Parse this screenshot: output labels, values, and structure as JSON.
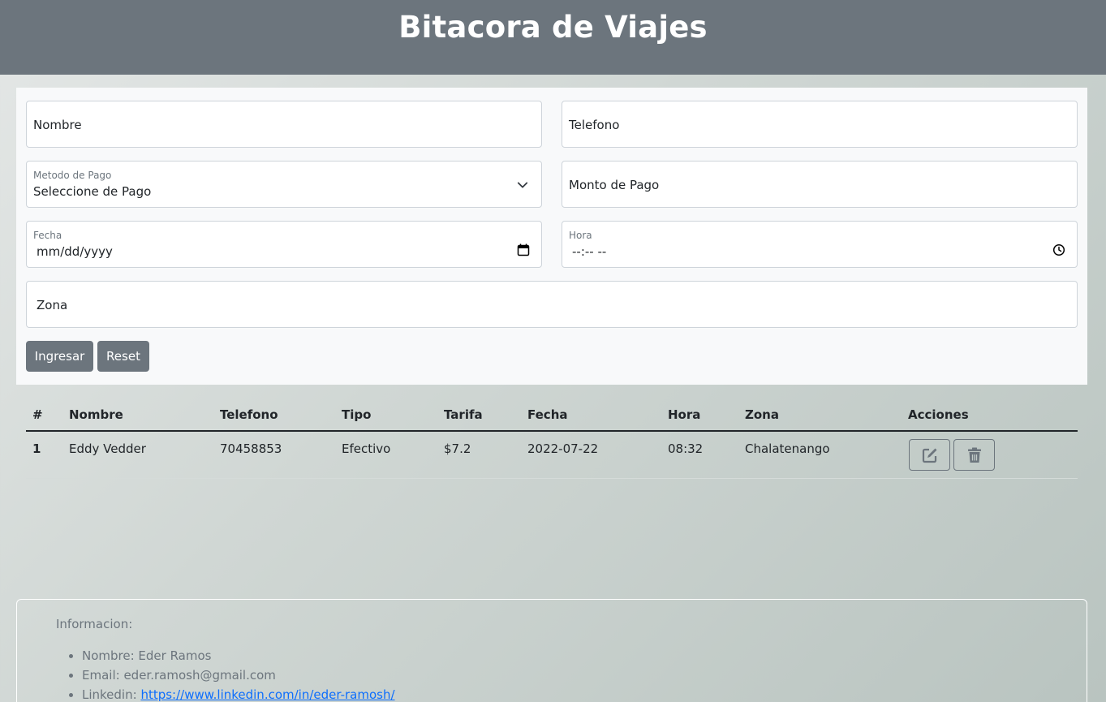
{
  "header": {
    "title": "Bitacora de Viajes"
  },
  "form": {
    "nombre_placeholder": "Nombre",
    "telefono_placeholder": "Telefono",
    "metodo_label": "Metodo de Pago",
    "metodo_value": "Seleccione de Pago",
    "monto_placeholder": "Monto de Pago",
    "fecha_label": "Fecha",
    "fecha_value": "mm/dd/yyyy",
    "hora_label": "Hora",
    "hora_value": "--:-- --",
    "zona_placeholder": "Zona",
    "ingresar_label": "Ingresar",
    "reset_label": "Reset"
  },
  "table": {
    "headers": [
      "#",
      "Nombre",
      "Telefono",
      "Tipo",
      "Tarifa",
      "Fecha",
      "Hora",
      "Zona",
      "Acciones"
    ],
    "rows": [
      [
        "1",
        "Eddy Vedder",
        "70458853",
        "Efectivo",
        "$7.2",
        "2022-07-22",
        "08:32",
        "Chalatenango"
      ]
    ]
  },
  "footer": {
    "title": "Informacion:",
    "items": [
      {
        "label": "Nombre: Eder Ramos"
      },
      {
        "label": "Email: eder.ramosh@gmail.com"
      },
      {
        "label": "Linkedin: ",
        "link": "https://www.linkedin.com/in/eder-ramosh/"
      }
    ]
  },
  "colors": {
    "header_bg": "#6c757d",
    "button_bg": "#6c757d",
    "link": "#0d6efd"
  },
  "icons": [
    "chevron-down-icon",
    "calendar-icon",
    "clock-icon",
    "edit-icon",
    "trash-icon"
  ]
}
